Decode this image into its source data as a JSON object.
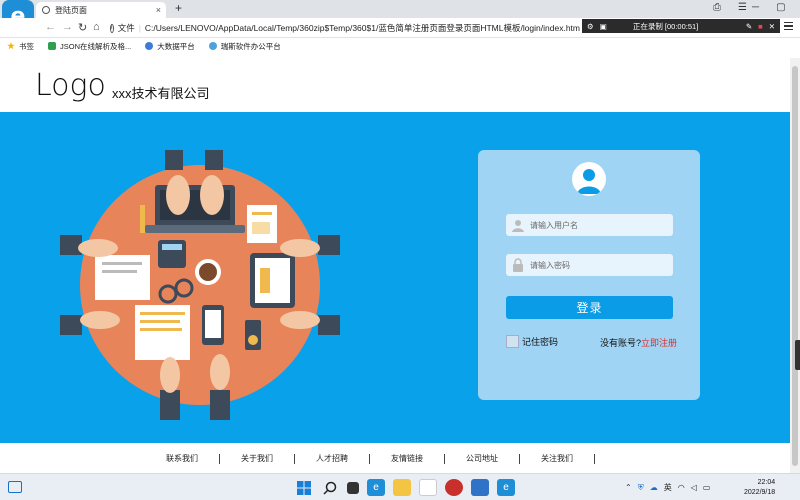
{
  "browser": {
    "tab_title": "登陆页面",
    "tab_close": "×",
    "new_tab": "+",
    "url_prefix": "文件",
    "url": "C:/Users/LENOVO/AppData/Local/Temp/360zip$Temp/360$1/蓝色简单注册页面登录页面HTML模板/login/index.htm",
    "recording_status": "正在录制 [00:00:51]",
    "window_controls": [
      "─",
      "▢",
      "✕"
    ],
    "bookmarks": [
      {
        "label": "书签",
        "color": "#f4b400"
      },
      {
        "label": "JSON在线解析及格...",
        "color": "#2e9e4f"
      },
      {
        "label": "大数据平台",
        "color": "#3b7dd8"
      },
      {
        "label": "瑞斯软件办公平台",
        "color": "#4aa3df"
      }
    ]
  },
  "header": {
    "logo": "Logo",
    "company": "xxx技术有限公司"
  },
  "login": {
    "username_placeholder": "请输入用户名",
    "password_placeholder": "请输入密码",
    "login_label": "登录",
    "remember_label": "记住密码",
    "no_account": "没有账号?",
    "register_label": "立即注册"
  },
  "footer": {
    "links": [
      "联系我们",
      "关于我们",
      "人才招聘",
      "友情链接",
      "公司地址",
      "关注我们"
    ]
  },
  "taskbar": {
    "ime": "英",
    "time": "22:04",
    "date": "2022/9/18"
  },
  "colors": {
    "hero_bg": "#0aa1eb",
    "card_bg": "#9fd4f4",
    "button": "#0b9ce8",
    "register_link": "#e02d2d",
    "table_orange": "#e8845a"
  }
}
